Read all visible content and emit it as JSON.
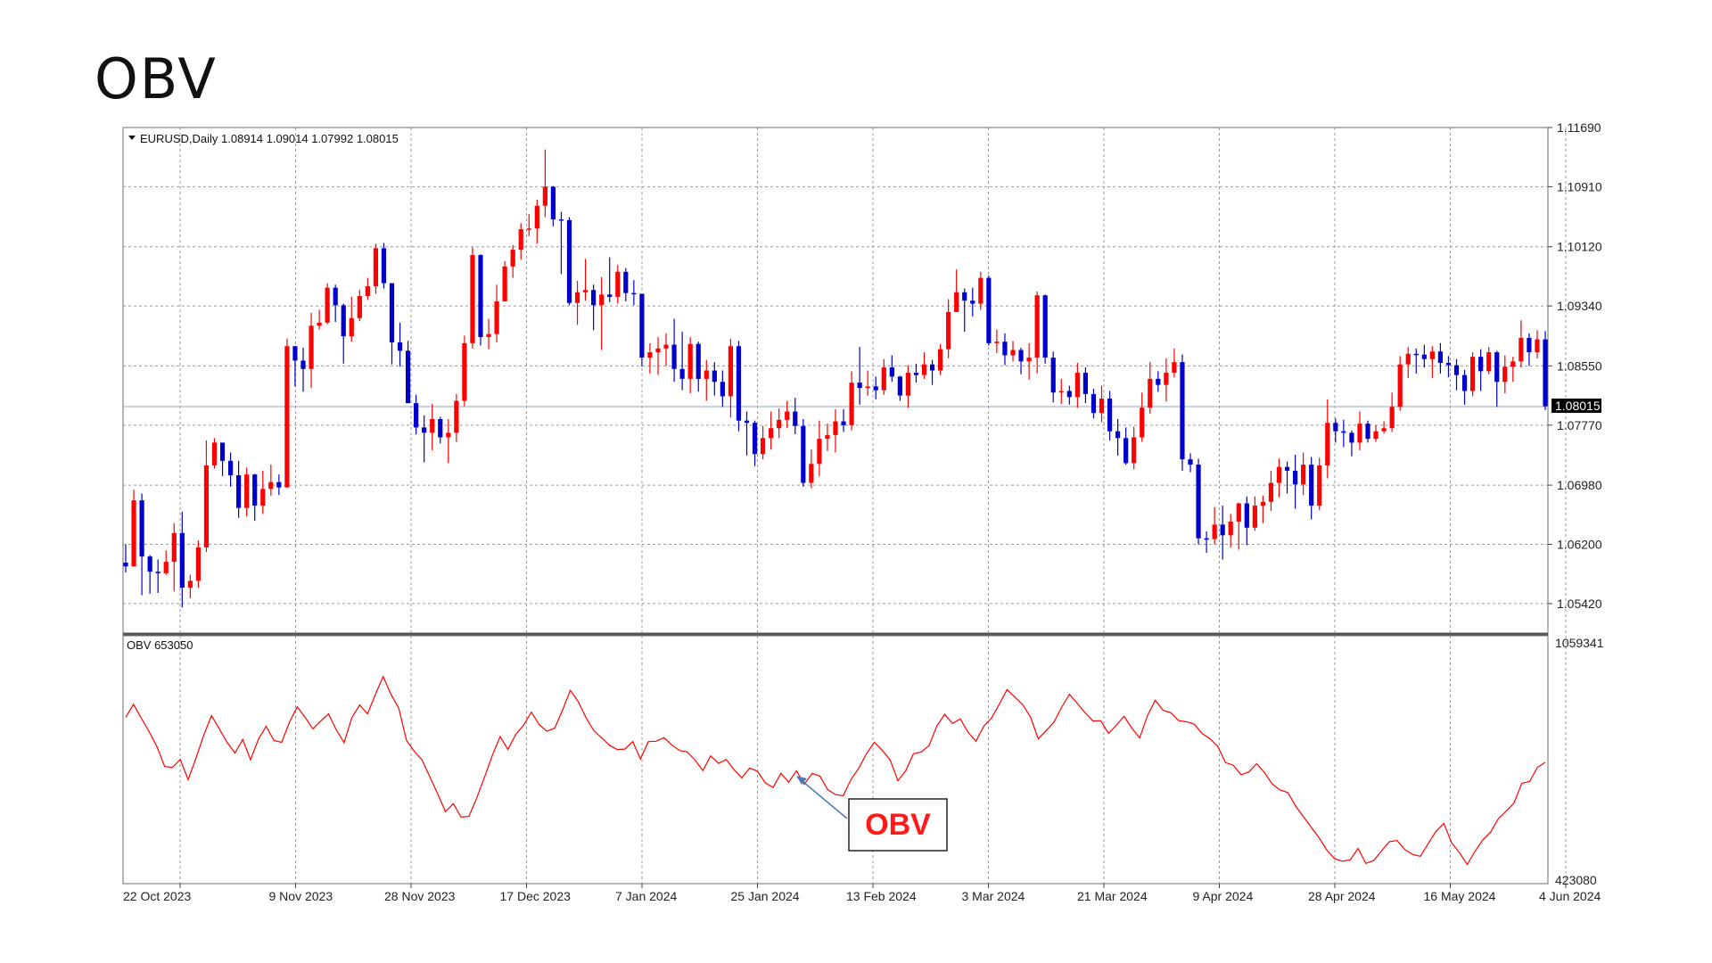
{
  "page_title": "OBV",
  "chart_data": [
    {
      "type": "candlestick",
      "title": "EURUSD,Daily 1.08914 1.09014 1.07992 1.08015",
      "symbol_label": "EURUSD,Daily",
      "ohlc_label": "1.08914 1.09014 1.07992 1.08015",
      "current_price": "1.08015",
      "ylim": [
        1.0502,
        1.1169
      ],
      "y_ticks": [
        "1.11690",
        "1.10910",
        "1.10120",
        "1.09340",
        "1.08550",
        "1.07770",
        "1.06980",
        "1.06200",
        "1.05420"
      ],
      "x_ticks": [
        "22 Oct 2023",
        "9 Nov 2023",
        "28 Nov 2023",
        "17 Dec 2023",
        "7 Jan 2024",
        "25 Jan 2024",
        "13 Feb 2024",
        "3 Mar 2024",
        "21 Mar 2024",
        "9 Apr 2024",
        "28 Apr 2024",
        "16 May 2024",
        "4 Jun 2024"
      ],
      "colors": {
        "up": "#ff0000",
        "down": "#0000cc",
        "grid": "#9a9a9a",
        "price_line": "#8fa3bf"
      },
      "close": [
        1.0591,
        1.0678,
        1.0604,
        1.0584,
        1.0582,
        1.0597,
        1.0635,
        1.0563,
        1.0572,
        1.0616,
        1.0724,
        1.0754,
        1.073,
        1.0711,
        1.0668,
        1.0712,
        1.0671,
        1.0693,
        1.0702,
        1.0695,
        1.0881,
        1.0862,
        1.0851,
        1.0908,
        1.0912,
        1.0958,
        1.0935,
        1.0894,
        1.0918,
        1.0947,
        1.096,
        1.101,
        1.0964,
        1.0886,
        1.0875,
        1.0806,
        1.0774,
        1.0767,
        1.0785,
        1.0761,
        1.0767,
        1.0809,
        1.0885,
        1.1001,
        1.0893,
        1.0897,
        1.094,
        1.0986,
        1.1008,
        1.1035,
        1.1036,
        1.1066,
        1.1091,
        1.1048,
        1.1047,
        1.0938,
        1.0952,
        1.0955,
        1.0935,
        1.0949,
        1.0946,
        1.0979,
        1.0951,
        1.095,
        1.0866,
        1.0873,
        1.0878,
        1.0883,
        1.0851,
        1.0838,
        1.0884,
        1.0838,
        1.0849,
        1.0834,
        1.0815,
        1.0881,
        1.0783,
        1.078,
        1.0739,
        1.076,
        1.0773,
        1.0784,
        1.0795,
        1.0776,
        1.0701,
        1.0726,
        1.0759,
        1.0764,
        1.0782,
        1.0777,
        1.0833,
        1.0826,
        1.0828,
        1.0823,
        1.0853,
        1.0841,
        1.0816,
        1.0846,
        1.0843,
        1.0857,
        1.0849,
        1.0877,
        1.0926,
        1.0952,
        1.0941,
        1.0937,
        1.0971,
        1.0885,
        1.0887,
        1.0869,
        1.0876,
        1.0861,
        1.0866,
        1.0948,
        1.0866,
        1.082,
        1.0822,
        1.0814,
        1.0846,
        1.0818,
        1.0793,
        1.0812,
        1.0769,
        1.076,
        1.0727,
        1.0761,
        1.08,
        1.0838,
        1.083,
        1.0846,
        1.086,
        1.0732,
        1.0725,
        1.0628,
        1.0627,
        1.0646,
        1.0632,
        1.065,
        1.0674,
        1.0642,
        1.0671,
        1.0676,
        1.0701,
        1.0722,
        1.0717,
        1.0699,
        1.0725,
        1.0671,
        1.0724,
        1.078,
        1.0769,
        1.0767,
        1.0754,
        1.0779,
        1.0759,
        1.0769,
        1.0773,
        1.0801,
        1.0857,
        1.0871,
        1.087,
        1.0864,
        1.0874,
        1.0859,
        1.0856,
        1.0843,
        1.0822,
        1.0867,
        1.0848,
        1.0873,
        1.0834,
        1.0854,
        1.0861,
        1.0892,
        1.0873,
        1.089,
        1.0802
      ],
      "high": [
        1.062,
        1.0692,
        1.0687,
        1.0606,
        1.06,
        1.0612,
        1.0648,
        1.0663,
        1.058,
        1.0625,
        1.0757,
        1.076,
        1.0745,
        1.0741,
        1.073,
        1.0721,
        1.0713,
        1.0717,
        1.0725,
        1.0712,
        1.0891,
        1.0881,
        1.0879,
        1.0925,
        1.0929,
        1.0964,
        1.0962,
        1.0937,
        1.0946,
        1.0955,
        1.0971,
        1.1016,
        1.1017,
        1.0964,
        1.0912,
        1.0888,
        1.0817,
        1.079,
        1.0805,
        1.0788,
        1.0785,
        1.0818,
        1.0895,
        1.1011,
        1.1002,
        1.0917,
        1.0962,
        1.0993,
        1.1014,
        1.1043,
        1.1055,
        1.1074,
        1.114,
        1.1092,
        1.1058,
        1.1051,
        1.0967,
        1.0996,
        1.0962,
        1.0972,
        1.0998,
        1.0988,
        1.0984,
        1.0968,
        1.095,
        1.0885,
        1.0893,
        1.0898,
        1.0917,
        1.09,
        1.0893,
        1.0887,
        1.0863,
        1.086,
        1.0849,
        1.0891,
        1.0888,
        1.0795,
        1.0783,
        1.0776,
        1.0795,
        1.0799,
        1.0809,
        1.0813,
        1.0785,
        1.0745,
        1.0783,
        1.0779,
        1.0798,
        1.0798,
        1.0848,
        1.088,
        1.0849,
        1.0841,
        1.0864,
        1.0869,
        1.0842,
        1.0856,
        1.0858,
        1.0873,
        1.0863,
        1.0884,
        1.0943,
        1.0982,
        1.0957,
        1.0958,
        1.0979,
        1.0974,
        1.0903,
        1.0898,
        1.0888,
        1.0879,
        1.0885,
        1.0953,
        1.0949,
        1.0874,
        1.0838,
        1.0829,
        1.0859,
        1.0853,
        1.0825,
        1.0829,
        1.0822,
        1.0785,
        1.0774,
        1.0775,
        1.082,
        1.086,
        1.0848,
        1.0865,
        1.0878,
        1.087,
        1.074,
        1.0733,
        1.0637,
        1.0669,
        1.0671,
        1.066,
        1.0675,
        1.0683,
        1.0683,
        1.0684,
        1.0717,
        1.0733,
        1.0729,
        1.0738,
        1.0741,
        1.0735,
        1.0734,
        1.0811,
        1.0786,
        1.0784,
        1.077,
        1.0795,
        1.0783,
        1.0777,
        1.0782,
        1.082,
        1.0868,
        1.088,
        1.0878,
        1.0883,
        1.0881,
        1.0885,
        1.0868,
        1.0864,
        1.085,
        1.0873,
        1.0877,
        1.088,
        1.0875,
        1.0869,
        1.0867,
        1.0915,
        1.0898,
        1.0902,
        1.0901
      ],
      "low": [
        1.0583,
        1.0591,
        1.0553,
        1.0555,
        1.0556,
        1.058,
        1.0558,
        1.0537,
        1.0549,
        1.0563,
        1.061,
        1.072,
        1.071,
        1.0696,
        1.0655,
        1.0657,
        1.0651,
        1.066,
        1.0684,
        1.0685,
        1.0695,
        1.0828,
        1.0821,
        1.0826,
        1.0903,
        1.091,
        1.0913,
        1.0858,
        1.0887,
        1.0914,
        1.0942,
        1.095,
        1.0957,
        1.0857,
        1.0854,
        1.085,
        1.0765,
        1.0728,
        1.0744,
        1.0753,
        1.0727,
        1.0755,
        1.0802,
        1.0878,
        1.0882,
        1.0877,
        1.0886,
        1.094,
        1.0971,
        1.0995,
        1.1026,
        1.1016,
        1.1051,
        1.1039,
        1.0976,
        1.0935,
        1.0909,
        1.0941,
        1.0902,
        1.0876,
        1.0939,
        1.0937,
        1.094,
        1.0935,
        1.0854,
        1.0845,
        1.0843,
        1.0855,
        1.0834,
        1.0823,
        1.0819,
        1.0821,
        1.0809,
        1.0816,
        1.0801,
        1.0787,
        1.0769,
        1.0737,
        1.0723,
        1.0732,
        1.0745,
        1.076,
        1.0773,
        1.0765,
        1.0696,
        1.0694,
        1.071,
        1.0743,
        1.0741,
        1.0768,
        1.077,
        1.0804,
        1.0816,
        1.0811,
        1.0817,
        1.0834,
        1.0809,
        1.08,
        1.0833,
        1.0838,
        1.083,
        1.0843,
        1.0865,
        1.0926,
        1.09,
        1.092,
        1.0929,
        1.0882,
        1.0872,
        1.0856,
        1.0861,
        1.0844,
        1.0837,
        1.0845,
        1.0858,
        1.0807,
        1.0805,
        1.0804,
        1.08,
        1.0806,
        1.0786,
        1.0781,
        1.0757,
        1.0737,
        1.0725,
        1.0719,
        1.0755,
        1.0792,
        1.0821,
        1.0808,
        1.084,
        1.0717,
        1.0715,
        1.062,
        1.0609,
        1.062,
        1.06,
        1.0616,
        1.0613,
        1.0619,
        1.0638,
        1.0648,
        1.0664,
        1.0682,
        1.0687,
        1.0667,
        1.0685,
        1.0653,
        1.0665,
        1.0707,
        1.0754,
        1.0748,
        1.0736,
        1.0744,
        1.0754,
        1.0755,
        1.0766,
        1.0768,
        1.0796,
        1.0839,
        1.0845,
        1.0853,
        1.0839,
        1.0845,
        1.084,
        1.0823,
        1.0804,
        1.0815,
        1.0822,
        1.0844,
        1.0801,
        1.0819,
        1.0834,
        1.0853,
        1.0855,
        1.0865,
        1.0797
      ]
    },
    {
      "type": "line",
      "title": "OBV 653050",
      "series": [
        {
          "name": "OBV",
          "color": "#ff0000"
        }
      ],
      "ylim": [
        423080,
        1059341
      ],
      "y_ticks": [
        "1059341",
        "423080"
      ],
      "values": [
        860000,
        897000,
        858000,
        820000,
        778000,
        722000,
        720000,
        742000,
        685000,
        745000,
        810000,
        865000,
        828000,
        790000,
        760000,
        798000,
        741000,
        798000,
        835000,
        795000,
        790000,
        847000,
        890000,
        860000,
        828000,
        850000,
        870000,
        825000,
        789000,
        860000,
        895000,
        870000,
        924000,
        975000,
        925000,
        886000,
        795000,
        765000,
        740000,
        693000,
        645000,
        595000,
        618000,
        580000,
        582000,
        633000,
        692000,
        753000,
        806000,
        770000,
        812000,
        838000,
        875000,
        840000,
        821000,
        830000,
        880000,
        936000,
        905000,
        860000,
        823000,
        803000,
        782000,
        770000,
        771000,
        792000,
        743000,
        792000,
        793000,
        803000,
        783000,
        767000,
        763000,
        740000,
        711000,
        752000,
        731000,
        742000,
        713000,
        690000,
        718000,
        709000,
        676000,
        663000,
        703000,
        678000,
        710000,
        672000,
        703000,
        695000,
        657000,
        643000,
        640000,
        686000,
        718000,
        759000,
        790000,
        767000,
        741000,
        682000,
        710000,
        758000,
        763000,
        781000,
        836000,
        869000,
        843000,
        856000,
        818000,
        793000,
        835000,
        858000,
        897000,
        938000,
        917000,
        896000,
        861000,
        800000,
        823000,
        846000,
        889000,
        925000,
        899000,
        873000,
        850000,
        851000,
        815000,
        838000,
        863000,
        830000,
        802000,
        865000,
        908000,
        880000,
        873000,
        851000,
        848000,
        841000,
        815000,
        800000,
        779000,
        733000,
        726000,
        699000,
        707000,
        730000,
        705000,
        673000,
        656000,
        649000,
        611000,
        581000,
        551000,
        522000,
        487000,
        463000,
        456000,
        460000,
        492000,
        450000,
        458000,
        485000,
        511000,
        514000,
        489000,
        475000,
        470000,
        506000,
        540000,
        562000,
        508000,
        480000,
        447000,
        484000,
        516000,
        538000,
        576000,
        597000,
        620000,
        675000,
        680000,
        720000,
        734000
      ],
      "note": "OBV"
    }
  ],
  "annotation": {
    "label": "OBV",
    "color": "#ff1a1a"
  }
}
